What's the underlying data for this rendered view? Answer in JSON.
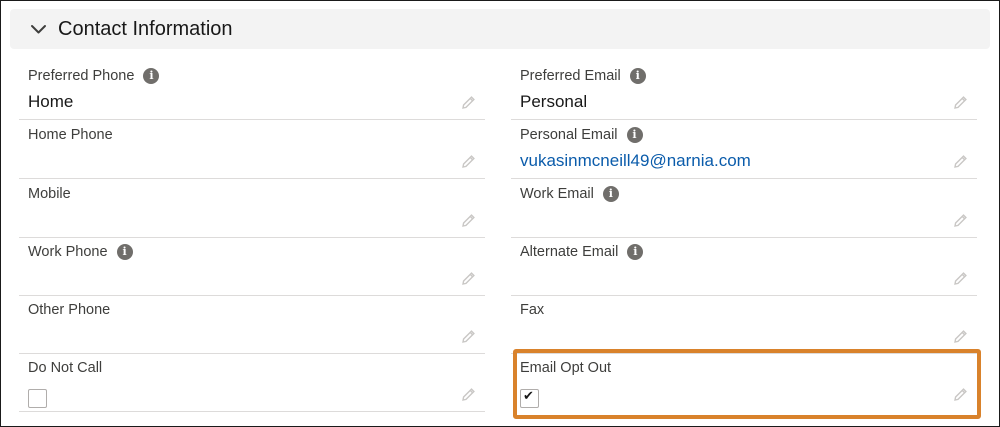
{
  "section": {
    "title": "Contact Information",
    "toggle_icon": "chevron-down-icon"
  },
  "left_fields": [
    {
      "label": "Preferred Phone",
      "has_info": true,
      "value": "Home"
    },
    {
      "label": "Home Phone",
      "has_info": false,
      "value": ""
    },
    {
      "label": "Mobile",
      "has_info": false,
      "value": ""
    },
    {
      "label": "Work Phone",
      "has_info": true,
      "value": ""
    },
    {
      "label": "Other Phone",
      "has_info": false,
      "value": ""
    },
    {
      "label": "Do Not Call",
      "has_info": false,
      "checkbox": true,
      "checked": false
    }
  ],
  "right_fields": [
    {
      "label": "Preferred Email",
      "has_info": true,
      "value": "Personal"
    },
    {
      "label": "Personal Email",
      "has_info": true,
      "value": "vukasinmcneill49@narnia.com",
      "is_link": true
    },
    {
      "label": "Work Email",
      "has_info": true,
      "value": ""
    },
    {
      "label": "Alternate Email",
      "has_info": true,
      "value": ""
    },
    {
      "label": "Fax",
      "has_info": false,
      "value": ""
    },
    {
      "label": "Email Opt Out",
      "has_info": false,
      "checkbox": true,
      "checked": true
    }
  ],
  "info_glyph": "i",
  "check_glyph": "✔",
  "colors": {
    "header_bg": "#f3f3f3",
    "link": "#0b5cab",
    "highlight": "#d9822b",
    "divider": "#dddbda"
  }
}
